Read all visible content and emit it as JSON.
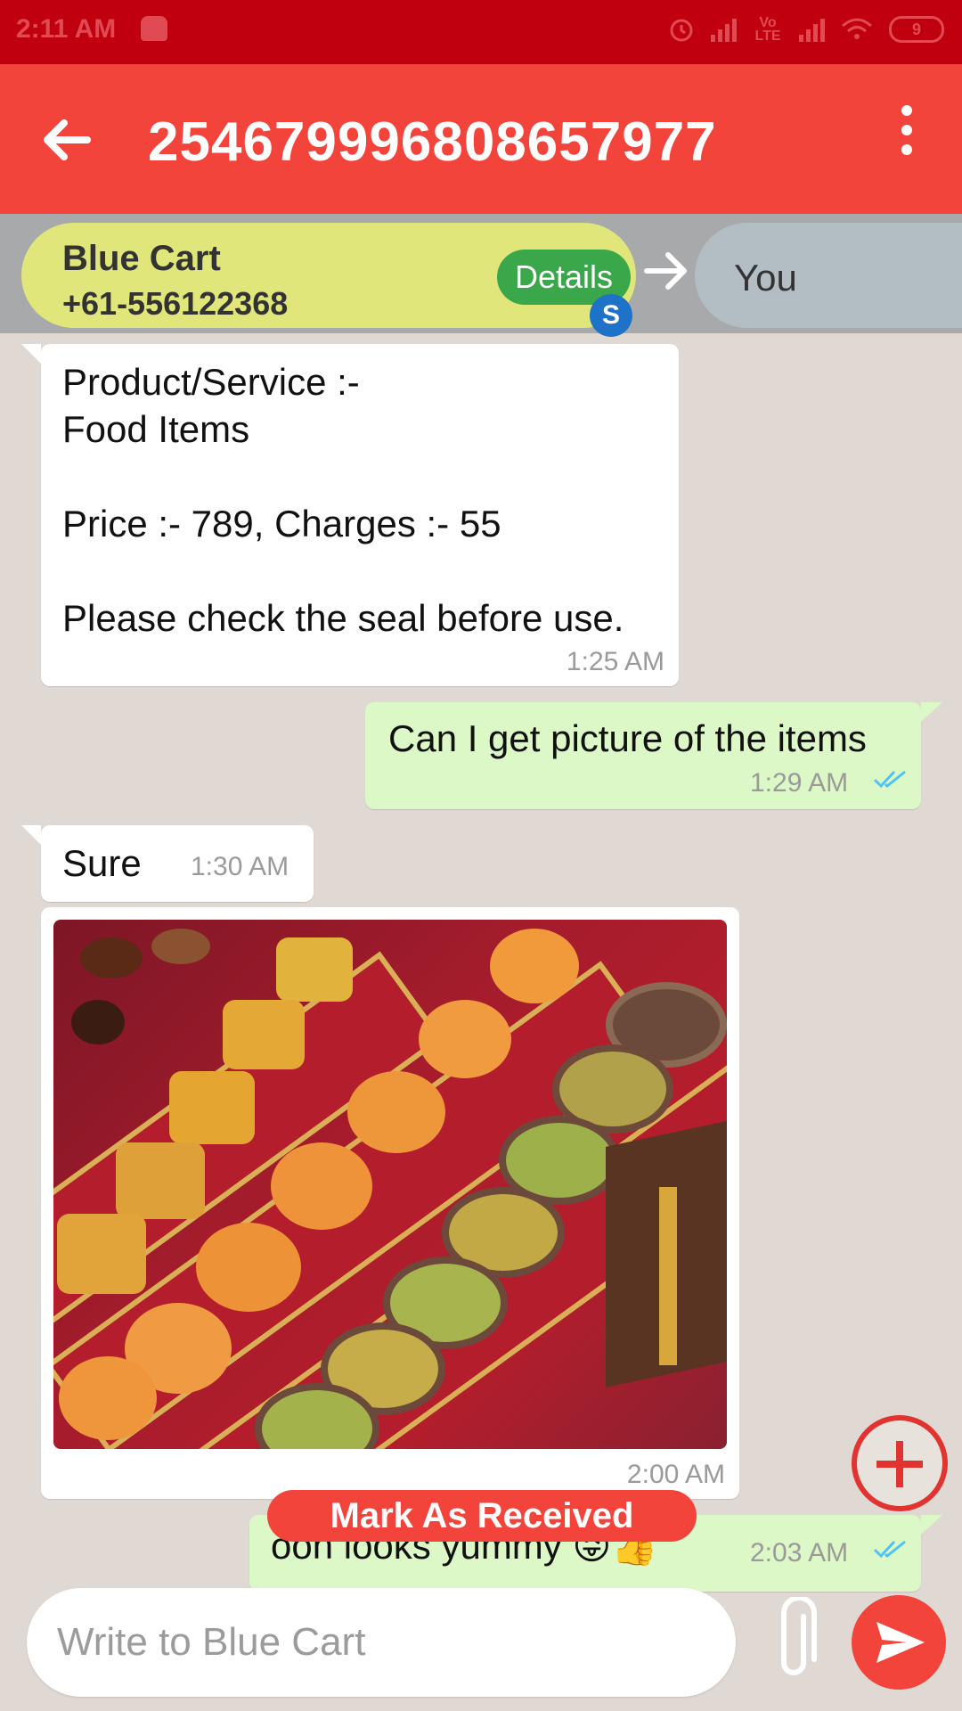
{
  "status_bar": {
    "time": "2:11 AM",
    "network": "Vo LTE",
    "battery": "9"
  },
  "app_bar": {
    "title": "254679996808657977",
    "back_icon": "arrow-left-icon",
    "menu_icon": "more-vertical-icon",
    "color": "#f2443b"
  },
  "route": {
    "sender_name": "Blue Cart",
    "sender_phone": "+61-556122368",
    "details_label": "Details",
    "badge_letter": "S",
    "recipient": "You"
  },
  "messages": [
    {
      "direction": "incoming",
      "text": "Product/Service :-\nFood Items\n\nPrice :- 789, Charges :- 55\n\nPlease check the seal before use.",
      "time": "1:25 AM"
    },
    {
      "direction": "outgoing",
      "text": "Can I get picture of the items",
      "time": "1:29 AM",
      "status": "read"
    },
    {
      "direction": "incoming",
      "text": "Sure",
      "time": "1:30 AM"
    },
    {
      "direction": "incoming",
      "type": "image",
      "image": "box of assorted indian sweets",
      "time": "2:00 AM"
    },
    {
      "direction": "outgoing",
      "text": "ooh looks yummy 😜👍",
      "time": "2:03 AM",
      "status": "read"
    }
  ],
  "actions": {
    "mark_received": "Mark As Received",
    "fab_icon": "plus-icon"
  },
  "composer": {
    "placeholder": "Write to Blue Cart",
    "attach_icon": "paperclip-icon",
    "send_icon": "send-icon"
  }
}
